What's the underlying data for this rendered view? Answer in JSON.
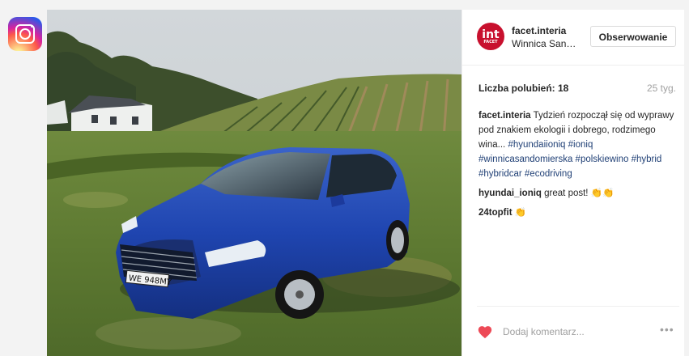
{
  "app": {
    "logo_icon": "instagram-icon"
  },
  "post": {
    "author": {
      "username": "facet.interia",
      "location": "Winnica San…",
      "avatar_text": "int",
      "avatar_sub": "FACET",
      "avatar_color": "#c8102e"
    },
    "follow_label": "Obserwowanie",
    "likes_label": "Liczba polubień: 18",
    "age": "25 tyg.",
    "caption": {
      "user": "facet.interia",
      "text": "Tydzień rozpoczął się od wyprawy pod znakiem ekologii i dobrego, rodzimego wina...",
      "tags": [
        "#hyundaiioniq",
        "#ioniq",
        "#winnicasandomierska",
        "#polskiewino",
        "#hybrid",
        "#hybridcar",
        "#ecodriving"
      ]
    },
    "comments": [
      {
        "user": "hyundai_ioniq",
        "text": "great post! 👏👏"
      },
      {
        "user": "24topfit",
        "text": "👏"
      }
    ],
    "add_comment_placeholder": "Dodaj komentarz...",
    "more_label": "•••",
    "like_color": "#ed4956",
    "plate": "WE 948MY"
  }
}
